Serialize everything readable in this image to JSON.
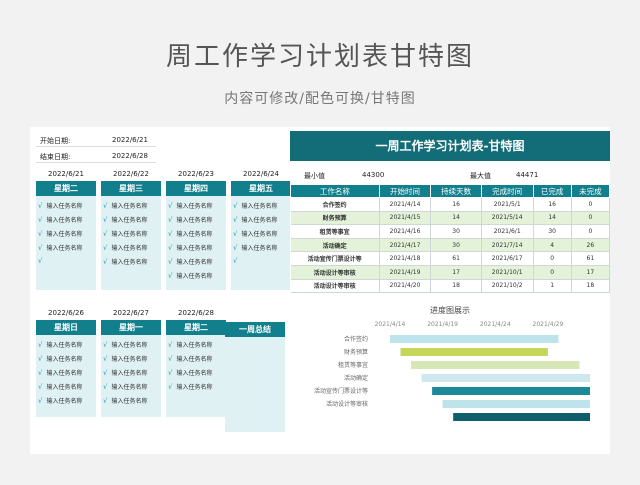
{
  "header": {
    "title": "周工作学习计划表甘特图",
    "subtitle": "内容可修改/配色可换/甘特图"
  },
  "dates": {
    "start_label": "开始日期:",
    "start_value": "2022/6/21",
    "end_label": "结束日期:",
    "end_value": "2022/6/28"
  },
  "days_row1": [
    {
      "date": "2022/6/21",
      "name": "星期二",
      "tasks": [
        "输入任务名称",
        "输入任务名称",
        "输入任务名称",
        "输入任务名称",
        ""
      ]
    },
    {
      "date": "2022/6/22",
      "name": "星期三",
      "tasks": [
        "输入任务名称",
        "输入任务名称",
        "输入任务名称",
        "输入任务名称",
        "输入任务名称"
      ]
    },
    {
      "date": "2022/6/23",
      "name": "星期四",
      "tasks": [
        "输入任务名称",
        "输入任务名称",
        "输入任务名称",
        "输入任务名称",
        "输入任务名称",
        "输入任务名称"
      ]
    },
    {
      "date": "2022/6/24",
      "name": "星期五",
      "tasks": [
        "输入任务名称",
        "输入任务名称",
        "输入任务名称",
        "输入任务名称",
        ""
      ]
    }
  ],
  "days_row2": [
    {
      "date": "2022/6/26",
      "name": "星期日",
      "tasks": [
        "输入任务名称",
        "输入任务名称",
        "输入任务名称",
        "输入任务名称",
        "输入任务名称"
      ]
    },
    {
      "date": "2022/6/27",
      "name": "星期一",
      "tasks": [
        "输入任务名称",
        "输入任务名称",
        "输入任务名称",
        "输入任务名称",
        "输入任务名称"
      ]
    },
    {
      "date": "2022/6/28",
      "name": "星期二",
      "tasks": [
        "输入任务名称",
        "输入任务名称",
        "输入任务名称",
        "输入任务名称"
      ]
    }
  ],
  "summary": {
    "title": "一周总结"
  },
  "gantt_table": {
    "banner": "一周工作学习计划表-甘特图",
    "min_label": "最小值",
    "min_value": "44300",
    "max_label": "最大值",
    "max_value": "44471",
    "columns": [
      "工作名称",
      "开始时间",
      "持续天数",
      "完成时间",
      "已完成",
      "未完成"
    ],
    "rows": [
      [
        "合作签约",
        "2021/4/14",
        "16",
        "2021/5/1",
        "16",
        "0"
      ],
      [
        "财务预算",
        "2021/4/15",
        "14",
        "2021/5/14",
        "14",
        "0"
      ],
      [
        "租赁等事宜",
        "2021/4/16",
        "30",
        "2021/6/1",
        "30",
        "0"
      ],
      [
        "活动确定",
        "2021/4/17",
        "30",
        "2021/7/14",
        "4",
        "26"
      ],
      [
        "活动宣传门票设计等",
        "2021/4/18",
        "61",
        "2021/6/17",
        "0",
        "61"
      ],
      [
        "活动设计等审核",
        "2021/4/19",
        "17",
        "2021/10/1",
        "0",
        "17"
      ],
      [
        "活动设计等审核",
        "2021/4/20",
        "18",
        "2021/10/2",
        "1",
        "18"
      ]
    ]
  },
  "chart_data": {
    "type": "bar",
    "title": "进度图展示",
    "x_ticks": [
      "2021/4/14",
      "2021/4/19",
      "2021/4/24",
      "2021/4/29"
    ],
    "categories": [
      "合作签约",
      "财务预算",
      "租赁等事宜",
      "活动确定",
      "活动宣传门票设计等",
      "活动设计等审核",
      ""
    ],
    "x_start_day": 0,
    "x_end_day": 19,
    "bars": [
      {
        "start": 0,
        "length": 16,
        "color": "#bfe3ea"
      },
      {
        "start": 1,
        "length": 14,
        "color": "#c6d65a"
      },
      {
        "start": 2,
        "length": 16,
        "color": "#d6e6b5"
      },
      {
        "start": 3,
        "length": 16,
        "color": "#cfe8ef"
      },
      {
        "start": 4,
        "length": 15,
        "color": "#1a8a99"
      },
      {
        "start": 5,
        "length": 14,
        "color": "#bfe3ea"
      },
      {
        "start": 6,
        "length": 13,
        "color": "#0f5e6b"
      }
    ]
  },
  "colors": {
    "accent": "#127f8c",
    "banner": "#136d78",
    "light": "#e0f1f4"
  }
}
